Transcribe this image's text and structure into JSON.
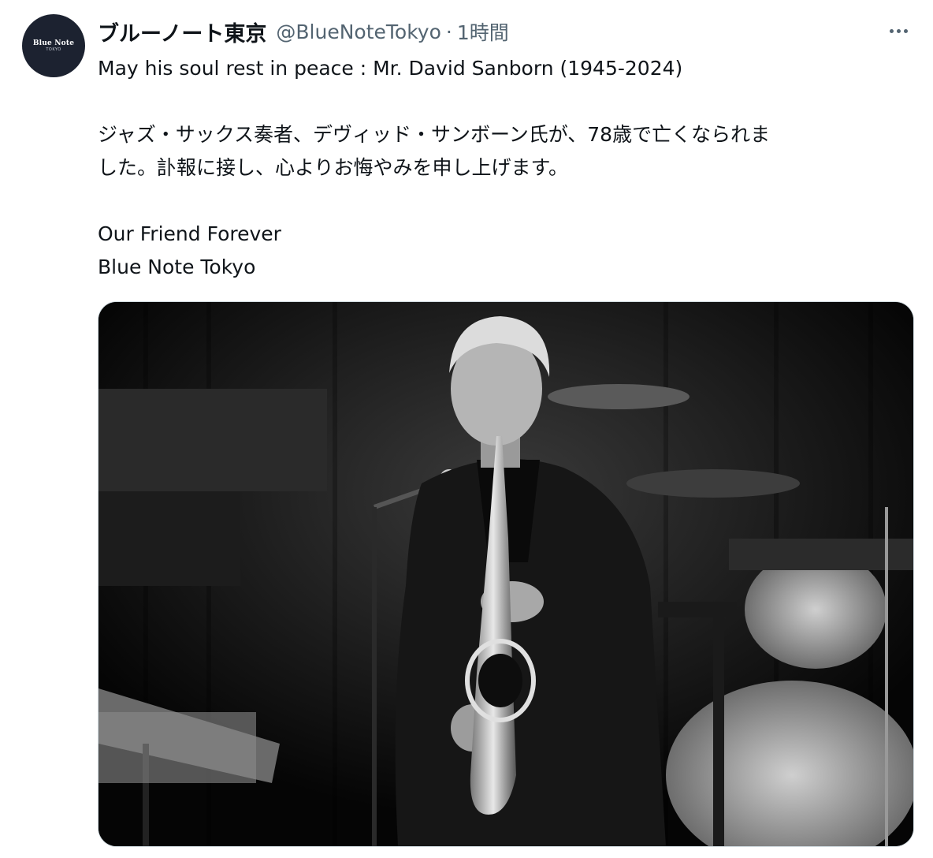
{
  "tweet": {
    "author": {
      "display_name": "ブルーノート東京",
      "handle": "@BlueNoteTokyo",
      "avatar_logo": "Blue Note",
      "avatar_sub": "TOKYO"
    },
    "separator": "·",
    "time": "1時間",
    "more_icon": "more-horizontal-icon",
    "text": {
      "line1": "May his soul rest in peace : Mr. David Sanborn (1945-2024)",
      "line2": "ジャズ・サックス奏者、デヴィッド・サンボーン氏が、78歳で亡くなられま",
      "line3": "した。訃報に接し、心よりお悔やみを申し上げます。",
      "line4": "Our Friend Forever",
      "line5": "Blue Note Tokyo"
    },
    "media": {
      "type": "photo",
      "style": "black-and-white"
    }
  }
}
